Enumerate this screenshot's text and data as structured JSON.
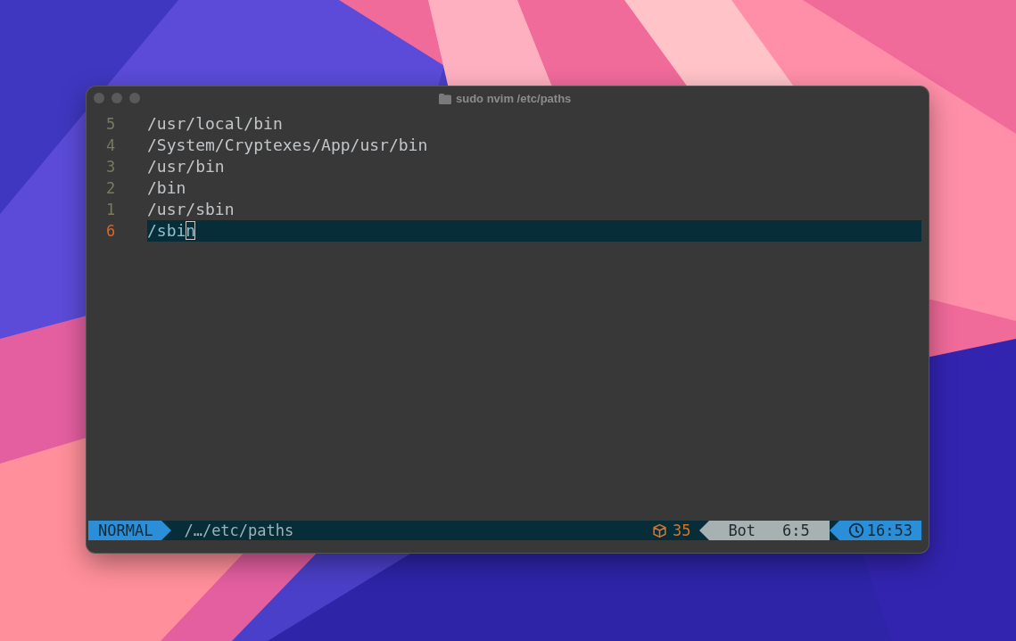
{
  "window": {
    "title": "sudo nvim /etc/paths"
  },
  "lines": [
    {
      "number": "5",
      "text": "/usr/local/bin",
      "current": false
    },
    {
      "number": "4",
      "text": "/System/Cryptexes/App/usr/bin",
      "current": false
    },
    {
      "number": "3",
      "text": "/usr/bin",
      "current": false
    },
    {
      "number": "2",
      "text": "/bin",
      "current": false
    },
    {
      "number": "1",
      "text": "/usr/sbin",
      "current": false
    },
    {
      "number": "6",
      "text": "/sbi",
      "cursor_char": "n",
      "current": true
    }
  ],
  "status_bar": {
    "mode": "NORMAL",
    "path": "/…/etc/paths",
    "count": "35",
    "position": "Bot",
    "cursor": "6:5",
    "time": "16:53"
  }
}
